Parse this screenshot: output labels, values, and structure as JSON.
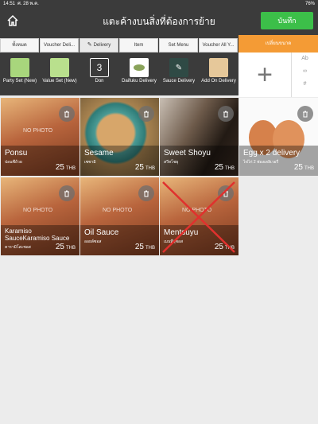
{
  "status": {
    "time": "14:51",
    "date": "ศ. 28 พ.ค.",
    "battery": "76%"
  },
  "header": {
    "title": "แตะค้างบนสิ่งที่ต้องการย้าย",
    "save_label": "บันทึก"
  },
  "tabs": [
    {
      "label": "ทั้งหมด"
    },
    {
      "label": "Voucher Deli..."
    },
    {
      "label": "Delivery"
    },
    {
      "label": "Item"
    },
    {
      "label": "Set Menu"
    },
    {
      "label": "Voucher All Y..."
    }
  ],
  "categories": [
    {
      "label": "Party Set (New)"
    },
    {
      "label": "Value Set (New)"
    },
    {
      "label": "Don",
      "thumb_text": "3"
    },
    {
      "label": "Daifuku Delivery"
    },
    {
      "label": "Sauce Delivery"
    },
    {
      "label": "Add On Delivery"
    }
  ],
  "side": {
    "change_size_label": "เปลี่ยนขนาด",
    "options": [
      "Ab",
      "",
      "#"
    ]
  },
  "products": [
    {
      "name": "Ponsu",
      "name_th": "ปอนซึถ้วย",
      "price": "25",
      "currency": "THB"
    },
    {
      "name": "Sesame",
      "name_th": "เซซามิ",
      "price": "25",
      "currency": "THB"
    },
    {
      "name": "Sweet Shoyu",
      "name_th": "สวีทโชยุ",
      "price": "25",
      "currency": "THB"
    },
    {
      "name": "Egg x 2 delivery",
      "name_th": "ไข่ไก่ 2 ฟองเดลิเวอรี่",
      "price": "25",
      "currency": "THB"
    },
    {
      "name": "Karamiso SauceKaramiso Sauce",
      "name_th": "คารามิโสะซอส",
      "price": "25",
      "currency": "THB"
    },
    {
      "name": "Oil Sauce",
      "name_th": "ออยล์ซอส",
      "price": "25",
      "currency": "THB"
    },
    {
      "name": "Mentsuyu",
      "name_th": "เมนทึยุซอส",
      "price": "25",
      "currency": "THB"
    }
  ],
  "nophoto_text": "NO PHOTO"
}
